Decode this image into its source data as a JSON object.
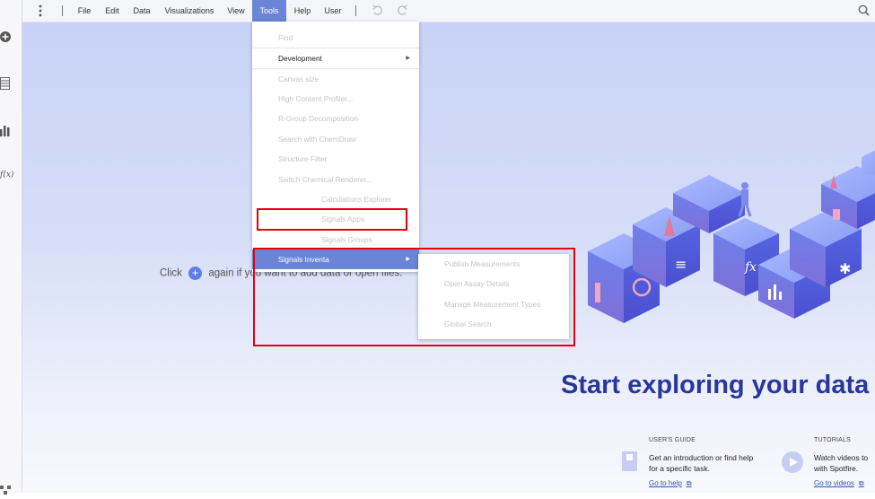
{
  "menubar": {
    "items": [
      "File",
      "Edit",
      "Data",
      "Visualizations",
      "View",
      "Tools",
      "Help",
      "User"
    ],
    "active_item": "Tools"
  },
  "tools_menu": {
    "items": [
      {
        "label": "Find",
        "enabled": false
      },
      {
        "label": "Development",
        "enabled": true,
        "has_submenu": true
      },
      {
        "label": "Canvas size",
        "enabled": false
      },
      {
        "label": "High Content Profiler...",
        "enabled": false
      },
      {
        "label": "R-Group Decomposition",
        "enabled": false
      },
      {
        "label": "Search with ChemDraw",
        "enabled": false
      },
      {
        "label": "Structure Filter",
        "enabled": false
      },
      {
        "label": "Switch Chemical Renderer...",
        "enabled": false
      },
      {
        "label": "Calculations Explorer",
        "enabled": false
      },
      {
        "label": "Signals Apps",
        "enabled": false
      },
      {
        "label": "Signals Groups",
        "enabled": false
      },
      {
        "label": "Signals Inventa",
        "enabled": true,
        "has_submenu": true,
        "highlighted": true
      }
    ]
  },
  "inventa_submenu": {
    "items": [
      {
        "label": "Publish Measurements",
        "enabled": false
      },
      {
        "label": "Open Assay Details",
        "enabled": false
      },
      {
        "label": "Manage Measurement Types",
        "enabled": false
      },
      {
        "label": "Global Search",
        "enabled": false
      }
    ]
  },
  "canvas": {
    "click_prefix": "Click",
    "click_suffix": "again if you want to add data or open files.",
    "headline": "Start exploring your data in"
  },
  "users_guide": {
    "title": "USER'S GUIDE",
    "line1": "Get an introduction or find help",
    "line2": "for a specific task.",
    "link": "Go to help"
  },
  "tutorials": {
    "title": "TUTORIALS",
    "line1": "Watch videos to",
    "line2": "with Spotfire.",
    "link": "Go to videos"
  },
  "icons": [
    "more-vertical-icon",
    "undo-icon",
    "redo-icon",
    "search-icon",
    "add-data-icon",
    "data-table-icon",
    "bar-chart-icon",
    "function-icon",
    "network-icon",
    "book-icon",
    "play-icon",
    "external-link-icon",
    "submenu-arrow-icon"
  ],
  "colors": {
    "menu_highlight": "#6a85d6",
    "annotation_red": "#e8000b",
    "headline": "#28389a",
    "link": "#2e52b8",
    "accent_plus": "#5f7fe6"
  }
}
